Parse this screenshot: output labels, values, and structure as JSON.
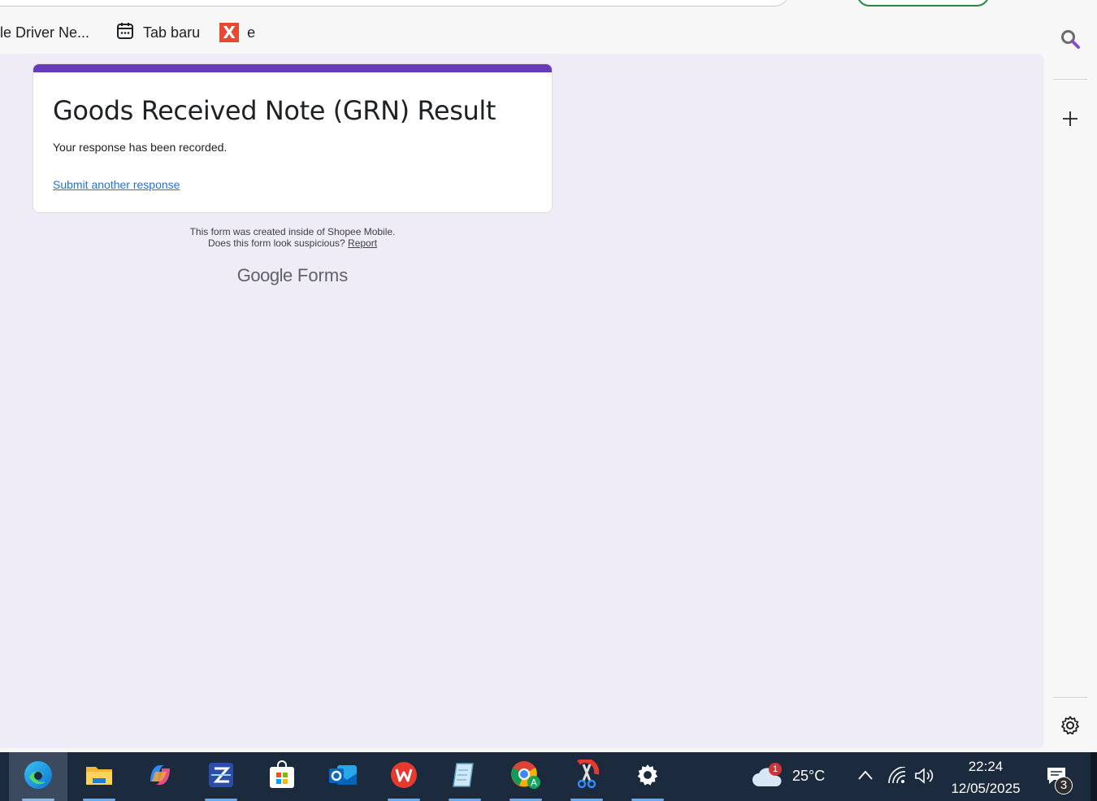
{
  "bookmarks": [
    {
      "label": "le Driver Ne..."
    },
    {
      "label": "Tab baru",
      "icon": "calendar-tab-icon"
    },
    {
      "label": "e",
      "icon": "x-logo-icon"
    }
  ],
  "form": {
    "title": "Goods Received Note (GRN) Result",
    "message": "Your response has been recorded.",
    "submit_another": "Submit another response",
    "accent_color": "#673ab7",
    "footer_line1": "This form was created inside of Shopee Mobile.",
    "footer_line2": "Does this form look suspicious?",
    "report_link": "Report",
    "brand_google": "Google",
    "brand_forms": "Forms"
  },
  "sidebar": {
    "icons": [
      "search-icon",
      "plus-icon",
      "settings-icon"
    ]
  },
  "taskbar": {
    "apps": [
      "edge-icon",
      "file-explorer-icon",
      "copilot-icon",
      "scanner-icon",
      "store-icon",
      "outlook-icon",
      "wps-icon",
      "notepad-icon",
      "chrome-icon",
      "snipping-tool-icon",
      "settings-icon"
    ],
    "weather_badge": "1",
    "temperature": "25°C",
    "time": "22:24",
    "date": "12/05/2025",
    "notification_count": "3"
  }
}
